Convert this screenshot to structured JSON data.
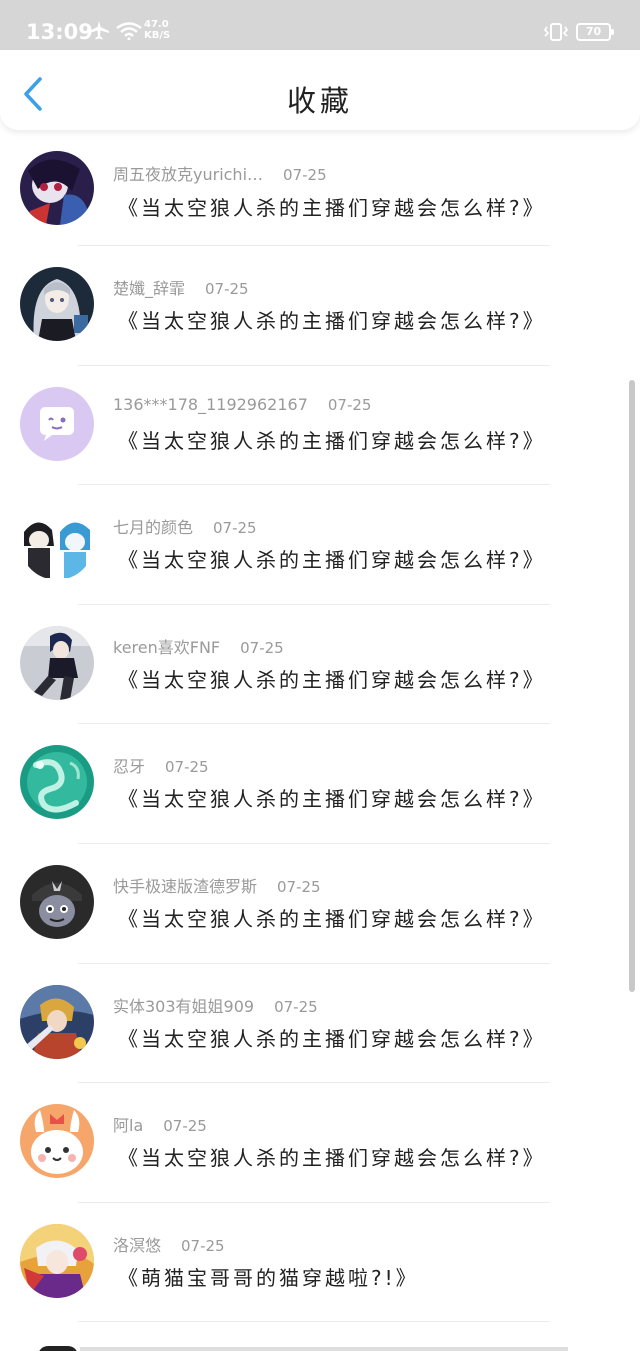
{
  "status_bar": {
    "time": "13:09",
    "speed_value": "47.0",
    "speed_unit": "KB/S",
    "battery": "70",
    "icons": [
      "airplane-icon",
      "wifi-icon",
      "vibrate-icon",
      "battery-icon"
    ]
  },
  "header": {
    "title": "收藏",
    "back_icon": "chevron-left-icon",
    "accent_color": "#3aa0e8"
  },
  "items": [
    {
      "user": "周五夜放克yurichi…",
      "date": "07-25",
      "title": "《当太空狼人杀的主播们穿越会怎么样?》",
      "avatar": "dark-anime-avatar"
    },
    {
      "user": "楚孅_辞霏",
      "date": "07-25",
      "title": "《当太空狼人杀的主播们穿越会怎么样?》",
      "avatar": "silver-hair-anime-avatar"
    },
    {
      "user": "136***178_1192962167",
      "date": "07-25",
      "title": "《当太空狼人杀的主播们穿越会怎么样?》",
      "avatar": "default-chat-avatar"
    },
    {
      "user": "七月的颜色",
      "date": "07-25",
      "title": "《当太空狼人杀的主播们穿越会怎么样?》",
      "avatar": "chibi-pair-avatar"
    },
    {
      "user": "keren喜欢FNF",
      "date": "07-25",
      "title": "《当太空狼人杀的主播们穿越会怎么样?》",
      "avatar": "seated-character-avatar"
    },
    {
      "user": "忍牙",
      "date": "07-25",
      "title": "《当太空狼人杀的主播们穿越会怎么样?》",
      "avatar": "jade-dragon-avatar"
    },
    {
      "user": "快手极速版渣德罗斯",
      "date": "07-25",
      "title": "《当太空狼人杀的主播们穿越会怎么样?》",
      "avatar": "dark-cap-character-avatar"
    },
    {
      "user": "实体303有姐姐909",
      "date": "07-25",
      "title": "《当太空狼人杀的主播们穿越会怎么样?》",
      "avatar": "game-hero-avatar"
    },
    {
      "user": "阿la",
      "date": "07-25",
      "title": "《当太空狼人杀的主播们穿越会怎么样?》",
      "avatar": "cute-bunny-avatar"
    },
    {
      "user": "洛溟悠",
      "date": "07-25",
      "title": "《萌猫宝哥哥的猫穿越啦?!》",
      "avatar": "colorful-anime-avatar"
    }
  ]
}
